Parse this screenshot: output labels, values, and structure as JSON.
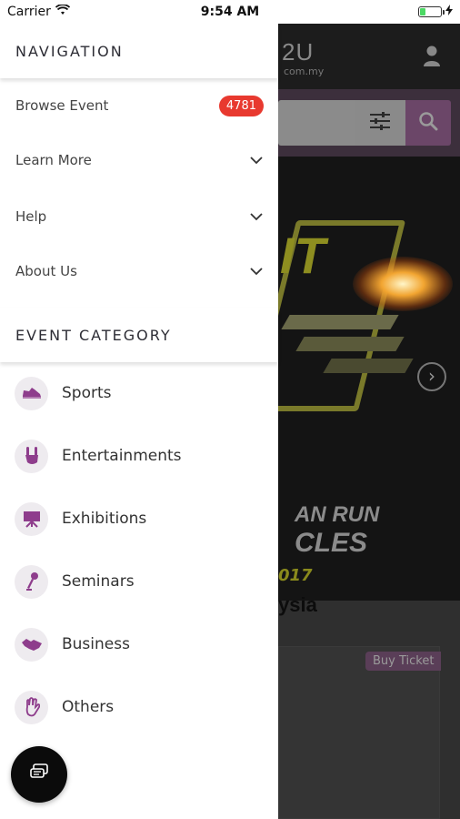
{
  "status_bar": {
    "carrier": "Carrier",
    "time": "9:54 AM",
    "battery_level": 0.25
  },
  "background": {
    "logo": "2U",
    "logo_sub": "com.my",
    "heading": "ysia",
    "buy_ticket": "Buy Ticket",
    "banner_text_1": "AN RUN",
    "banner_text_2": "CLES",
    "banner_text_3": "017"
  },
  "drawer": {
    "navigation_title": "NAVIGATION",
    "nav_items": [
      {
        "label": "Browse Event",
        "badge": "4781"
      },
      {
        "label": "Learn More"
      },
      {
        "label": "Help"
      },
      {
        "label": "About Us"
      }
    ],
    "category_title": "EVENT CATEGORY",
    "categories": [
      {
        "label": "Sports",
        "icon": "shoe-icon"
      },
      {
        "label": "Entertainments",
        "icon": "rock-hand-icon"
      },
      {
        "label": "Exhibitions",
        "icon": "easel-icon"
      },
      {
        "label": "Seminars",
        "icon": "microphone-icon"
      },
      {
        "label": "Business",
        "icon": "handshake-icon"
      },
      {
        "label": "Others",
        "icon": "hand-icon"
      }
    ]
  },
  "colors": {
    "accent": "#8e3d8c",
    "badge": "#e8392f",
    "icon_bg": "#eeebef"
  }
}
